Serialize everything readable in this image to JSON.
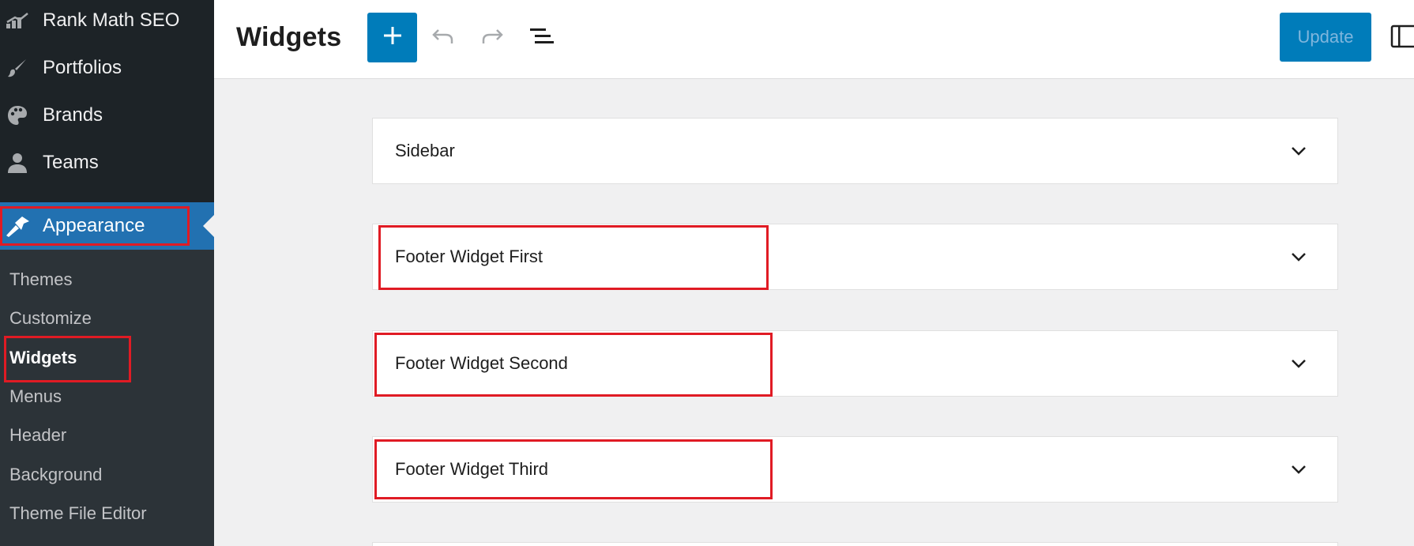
{
  "sidebar": {
    "top_items": [
      {
        "label": "Rank Math SEO",
        "icon": "rank-math-icon"
      },
      {
        "label": "Portfolios",
        "icon": "brush-icon"
      },
      {
        "label": "Brands",
        "icon": "palette-icon"
      },
      {
        "label": "Teams",
        "icon": "person-icon"
      }
    ],
    "active_item": {
      "label": "Appearance",
      "icon": "appearance-icon"
    },
    "submenu": [
      {
        "label": "Themes"
      },
      {
        "label": "Customize"
      },
      {
        "label": "Widgets",
        "current": true
      },
      {
        "label": "Menus"
      },
      {
        "label": "Header"
      },
      {
        "label": "Background"
      },
      {
        "label": "Theme File Editor"
      }
    ]
  },
  "header": {
    "title": "Widgets",
    "add_icon": "plus-icon",
    "undo_icon": "undo-icon",
    "redo_icon": "redo-icon",
    "list_view_icon": "list-view-icon",
    "update_label": "Update",
    "settings_icon": "sidebar-toggle-icon"
  },
  "widget_areas": [
    {
      "label": "Sidebar"
    },
    {
      "label": "Footer Widget First"
    },
    {
      "label": "Footer Widget Second"
    },
    {
      "label": "Footer Widget Third"
    }
  ],
  "colors": {
    "sidebar_bg": "#1d2327",
    "submenu_bg": "#2c3338",
    "accent": "#2271b1",
    "primary_button": "#007cba",
    "highlight": "#e01b24"
  }
}
